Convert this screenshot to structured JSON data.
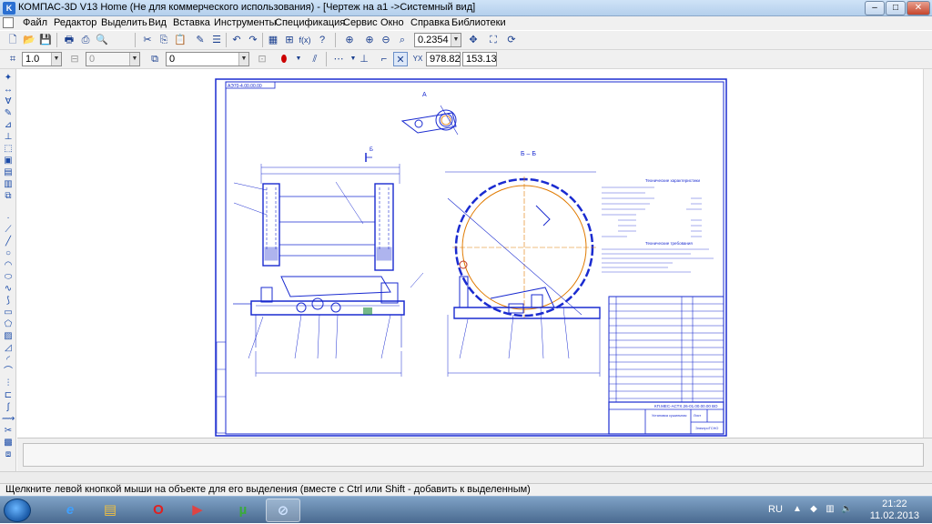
{
  "window": {
    "title": "КОМПАС-3D V13 Home (Не для коммерческого использования) - [Чертеж на а1 ->Системный вид]",
    "buttons": {
      "minimize": "–",
      "maximize": "□",
      "close": "✕"
    }
  },
  "menu": {
    "items": [
      "Файл",
      "Редактор",
      "Выделить",
      "Вид",
      "Вставка",
      "Инструменты",
      "Спецификация",
      "Сервис",
      "Окно",
      "Справка",
      "Библиотеки"
    ]
  },
  "toolbar1": {
    "zoom_value": "0.2354"
  },
  "toolbar2": {
    "line_scale": "1.0",
    "layer_value": "0",
    "style_value": "0",
    "coord_x_label": "X",
    "coord_y_label": "Y",
    "coord_x": "978.823",
    "coord_y": "153.138"
  },
  "drawing": {
    "stamp_top": "АЭ70-4.00.00.00",
    "view_a": "А",
    "view_b": "Б",
    "section_bb": "Б – Б",
    "tech_title": "Технические характеристики",
    "tech_req_title": "Технические требования",
    "title_block_code": "КП.МЕС-АСТХ.26-01.00.00.00 ВО",
    "title_block_name": "Установка сушильная",
    "sheet_label": "Лист",
    "org": "ЭлектроТСНО"
  },
  "status": {
    "hint": "Щелкните левой кнопкой мыши на объекте для его выделения (вместе с Ctrl или Shift - добавить к выделенным)"
  },
  "taskbar": {
    "lang": "RU",
    "time": "21:22",
    "date": "11.02.2013"
  },
  "colors": {
    "drawing_blue": "#1a2bd0",
    "axis_orange": "#e07a00",
    "titlebar": "#cfe3f7"
  }
}
